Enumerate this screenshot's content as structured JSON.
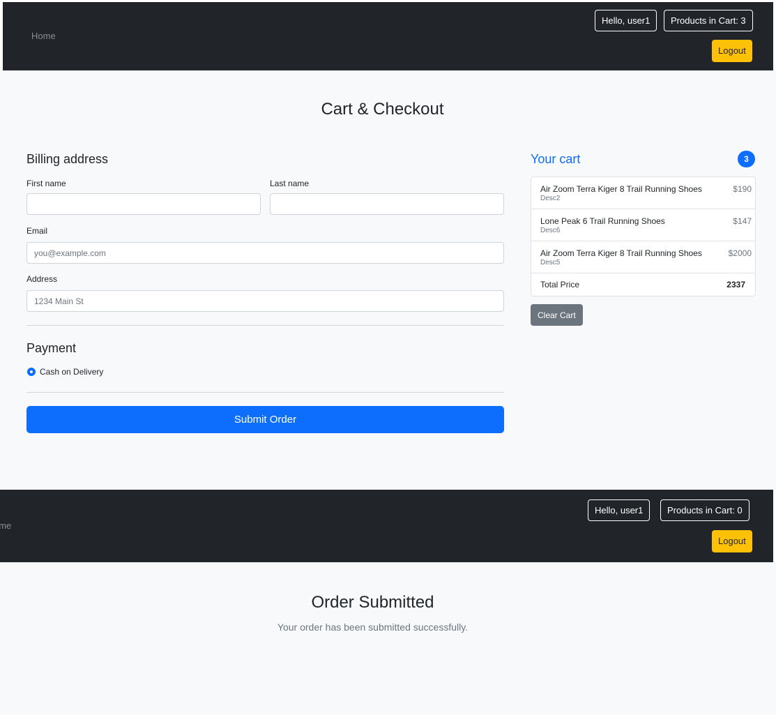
{
  "nav_top": {
    "home_label": "Home",
    "greeting": "Hello, user1",
    "cart_count": "Products in Cart: 3",
    "logout_label": "Logout"
  },
  "checkout": {
    "title": "Cart & Checkout",
    "billing": {
      "heading": "Billing address",
      "first_name_label": "First name",
      "first_name_value": "",
      "last_name_label": "Last name",
      "last_name_value": "",
      "email_label": "Email",
      "email_placeholder": "you@example.com",
      "address_label": "Address",
      "address_placeholder": "1234 Main St"
    },
    "payment": {
      "heading": "Payment",
      "option_label": "Cash on Delivery"
    },
    "submit_label": "Submit Order"
  },
  "cart": {
    "title": "Your cart",
    "badge": "3",
    "items": [
      {
        "name": "Air Zoom Terra Kiger 8 Trail Running Shoes",
        "desc": "Desc2",
        "price": "$190"
      },
      {
        "name": "Lone Peak 6 Trail Running Shoes",
        "desc": "Desc6",
        "price": "$147"
      },
      {
        "name": "Air Zoom Terra Kiger 8 Trail Running Shoes",
        "desc": "Desc5",
        "price": "$2000"
      }
    ],
    "total_label": "Total Price",
    "total_value": "2337",
    "clear_label": "Clear Cart"
  },
  "nav_bottom": {
    "home_label": "ome",
    "greeting": "Hello, user1",
    "cart_count": "Products in Cart: 0",
    "logout_label": "Logout"
  },
  "confirmation": {
    "title": "Order Submitted",
    "message": "Your order has been submitted successfully."
  },
  "colors": {
    "navbar": "#212529",
    "primary": "#0d6efd",
    "warning": "#ffc107",
    "secondary": "#6c757d",
    "page_bg": "#f8f9fa"
  }
}
